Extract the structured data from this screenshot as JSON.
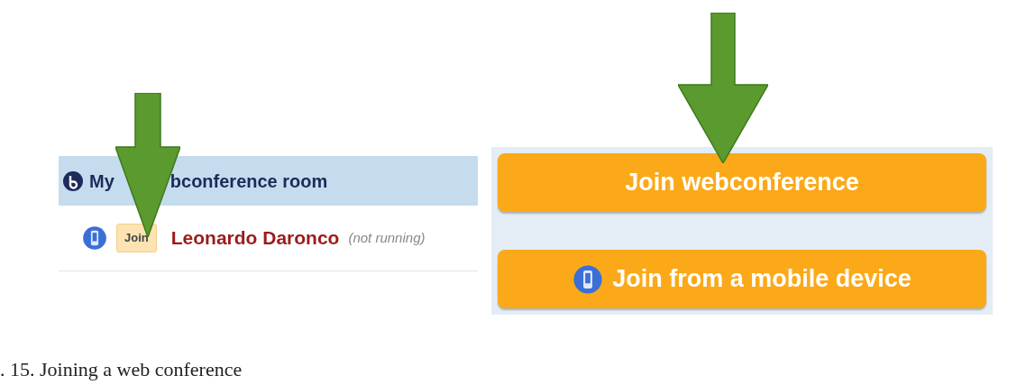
{
  "room_panel": {
    "title_start": "My",
    "title_end": "bconference room",
    "row": {
      "join_label": "Join",
      "owner": "Leonardo Daronco",
      "status": "(not running)"
    }
  },
  "join_panel": {
    "buttons": [
      {
        "label": "Join webconference",
        "kind": "plain"
      },
      {
        "label": "Join from a mobile device",
        "kind": "mobile"
      }
    ]
  },
  "caption": ". 15. Joining a web conference"
}
